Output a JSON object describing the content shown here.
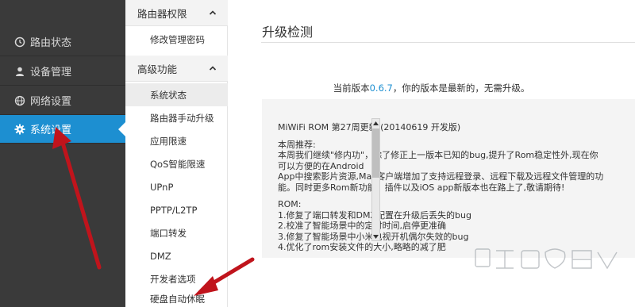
{
  "left_nav": {
    "items": [
      {
        "label": "路由状态",
        "icon": "clock-icon"
      },
      {
        "label": "设备管理",
        "icon": "user-icon"
      },
      {
        "label": "网络设置",
        "icon": "globe-icon"
      },
      {
        "label": "系统设置",
        "icon": "gear-icon",
        "active": true
      }
    ]
  },
  "sub_nav": {
    "groups": [
      {
        "title": "路由器权限",
        "items": [
          "修改管理密码"
        ]
      },
      {
        "title": "高级功能",
        "items": [
          "系统状态",
          "路由器手动升级",
          "应用限速",
          "QoS智能限速",
          "UPnP",
          "PPTP/L2TP",
          "端口转发",
          "DMZ",
          "开发者选项",
          "硬盘自动休眠"
        ]
      }
    ],
    "active_item": "系统状态"
  },
  "main": {
    "title": "升级检测",
    "version_prefix": "当前版本",
    "version": "0.6.7",
    "version_suffix": "，你的版本是最新的，无需升级。",
    "changelog": {
      "lines": [
        "MiWiFi ROM 第27周更新 (20140619 开发版)",
        "",
        "本周推荐:",
        "本周我们继续\"修内功\"，除了修正上一版本已知的bug,提升了Rom稳定性外,现在你可以方便的在Android",
        "App中搜索影片资源,Mac客户端增加了支持远程登录、远程下载及远程文件管理的功能。同时更多Rom新功能、插件以及iOS app新版本也在路上了,敬请期待!",
        "",
        "ROM:",
        "1.修复了端口转发和DMZ配置在升级后丢失的bug",
        "2.校准了智能场景中的定时时间,启停更准确",
        "3.修复了智能场景中小米电视开机偶尔失效的bug",
        "4.优化了rom安装文件的大小,略略的减了肥"
      ]
    }
  },
  "colors": {
    "accent": "#1d8fd1",
    "sidebar_bg": "#3a3a3a",
    "annotation": "#c0141c"
  }
}
